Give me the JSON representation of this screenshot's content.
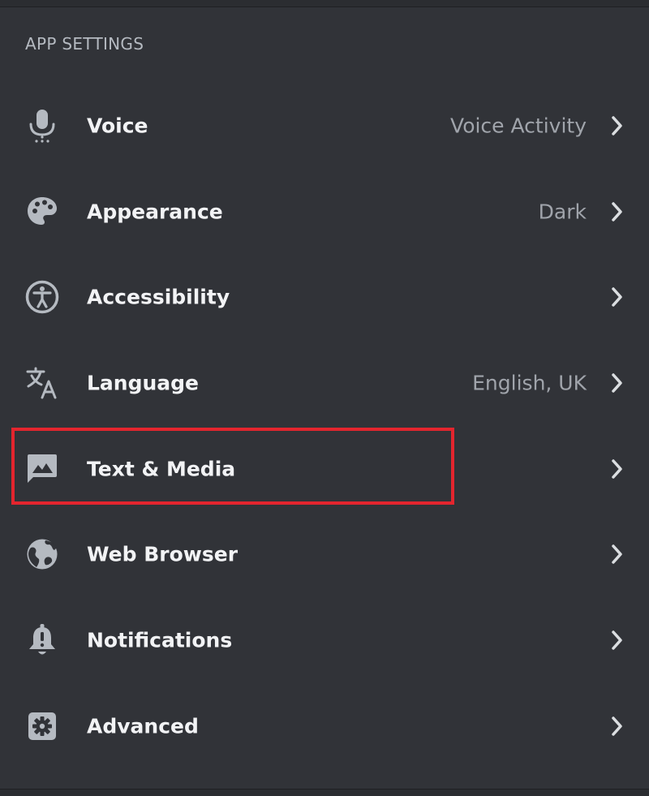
{
  "section": {
    "title": "APP SETTINGS"
  },
  "rows": [
    {
      "label": "Voice",
      "value": "Voice Activity",
      "icon": "microphone-icon"
    },
    {
      "label": "Appearance",
      "value": "Dark",
      "icon": "palette-icon"
    },
    {
      "label": "Accessibility",
      "value": "",
      "icon": "accessibility-icon"
    },
    {
      "label": "Language",
      "value": "English, UK",
      "icon": "translate-icon"
    },
    {
      "label": "Text & Media",
      "value": "",
      "icon": "image-icon"
    },
    {
      "label": "Web Browser",
      "value": "",
      "icon": "globe-icon"
    },
    {
      "label": "Notifications",
      "value": "",
      "icon": "bell-icon"
    },
    {
      "label": "Advanced",
      "value": "",
      "icon": "gear-icon"
    }
  ],
  "colors": {
    "background": "#313338",
    "label": "#f2f3f5",
    "value": "#a0a4ab",
    "icon": "#b5bac1",
    "highlight": "#e3252e"
  }
}
